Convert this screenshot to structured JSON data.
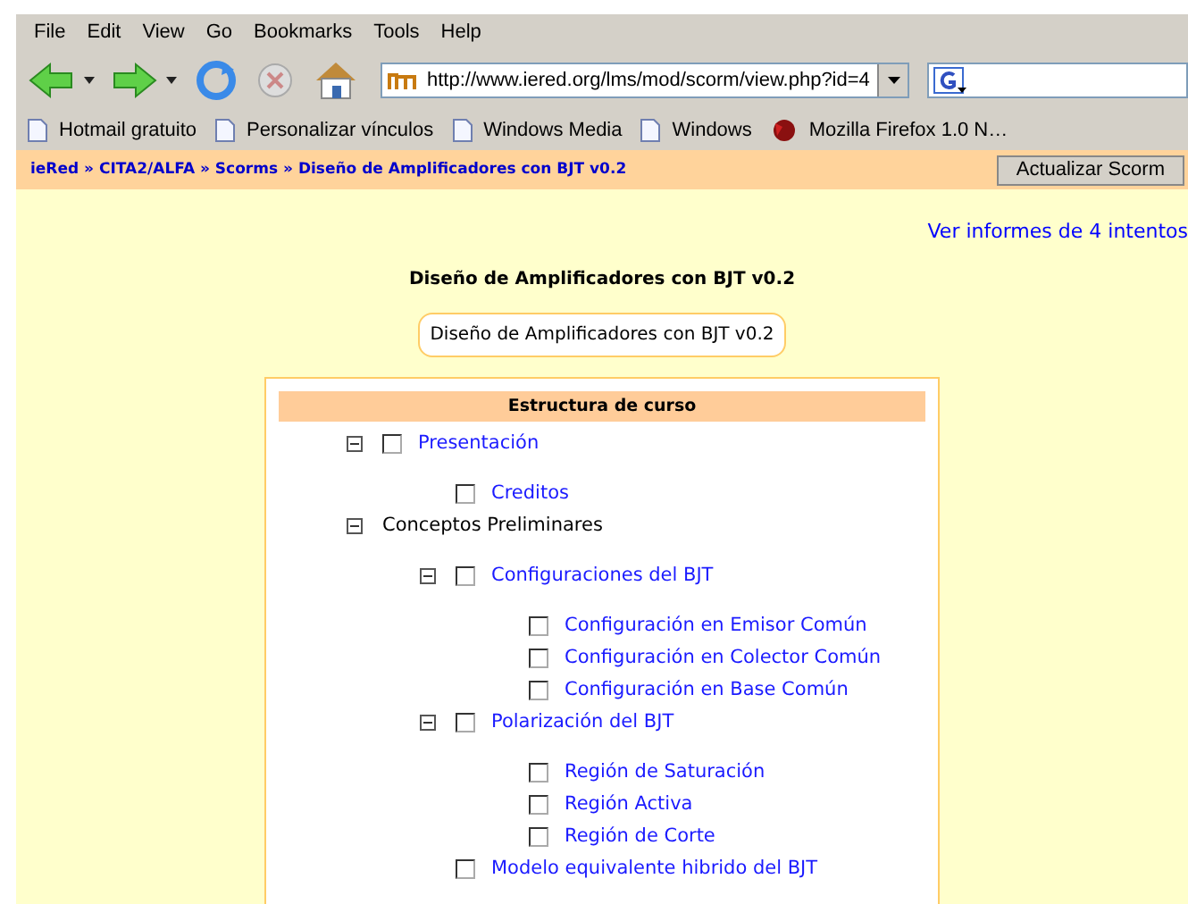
{
  "menu": [
    "File",
    "Edit",
    "View",
    "Go",
    "Bookmarks",
    "Tools",
    "Help"
  ],
  "address": {
    "value": "http://www.iered.org/lms/mod/scorm/view.php?id=4"
  },
  "bookmarks": [
    {
      "label": "Hotmail gratuito",
      "kind": "page"
    },
    {
      "label": "Personalizar vínculos",
      "kind": "page"
    },
    {
      "label": "Windows Media",
      "kind": "page"
    },
    {
      "label": "Windows",
      "kind": "page"
    },
    {
      "label": "Mozilla Firefox 1.0 N…",
      "kind": "firefox"
    }
  ],
  "breadcrumb": [
    "ieRed",
    "CITA2/ALFA",
    "Scorms",
    "Diseño de Amplificadores con BJT v0.2"
  ],
  "breadcrumb_separator": "»",
  "update_button": "Actualizar Scorm",
  "reports_link": "Ver informes de 4 intentos",
  "title": "Diseño de Amplificadores con BJT v0.2",
  "summary": "Diseño de Amplificadores con BJT v0.2",
  "structure": {
    "header": "Estructura de curso",
    "items": [
      {
        "label": "Presentación",
        "kind": "lesson",
        "checked": false,
        "expanded": true,
        "children": [
          {
            "label": "Creditos",
            "kind": "lesson",
            "checked": false
          }
        ]
      },
      {
        "label": "Conceptos Preliminares",
        "kind": "section",
        "expanded": true,
        "children": [
          {
            "label": "Configuraciones del BJT",
            "kind": "lesson",
            "checked": false,
            "expanded": true,
            "children": [
              {
                "label": "Configuración en Emisor Común",
                "kind": "lesson",
                "checked": false
              },
              {
                "label": "Configuración en Colector Común",
                "kind": "lesson",
                "checked": false
              },
              {
                "label": "Configuración en Base Común",
                "kind": "lesson",
                "checked": false
              }
            ]
          },
          {
            "label": "Polarización del BJT",
            "kind": "lesson",
            "checked": false,
            "expanded": true,
            "children": [
              {
                "label": "Región de Saturación",
                "kind": "lesson",
                "checked": false
              },
              {
                "label": "Región Activa",
                "kind": "lesson",
                "checked": false
              },
              {
                "label": "Región de Corte",
                "kind": "lesson",
                "checked": false
              }
            ]
          },
          {
            "label": "Modelo equivalente hibrido del BJT",
            "kind": "lesson",
            "checked": false
          }
        ]
      }
    ]
  }
}
